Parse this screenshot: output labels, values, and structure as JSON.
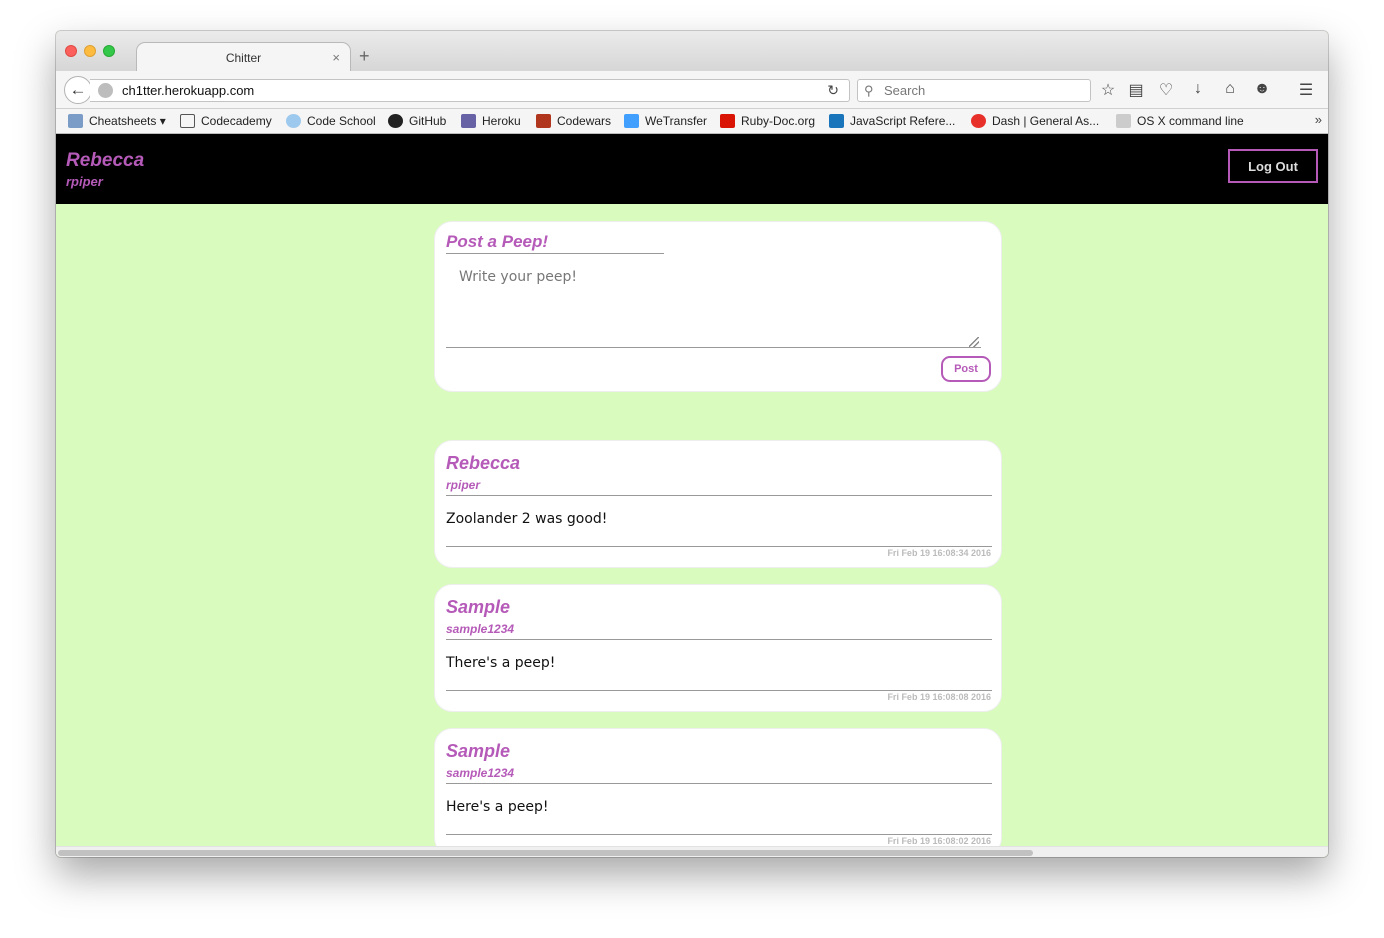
{
  "browser": {
    "tab_title": "Chitter",
    "tab_close": "×",
    "new_tab": "+",
    "url": "ch1tter.herokuapp.com",
    "search_placeholder": "Search",
    "bookmarks": [
      {
        "label": "Cheatsheets ▾",
        "icon": "folder-icon",
        "color": "#7a9cc6"
      },
      {
        "label": "Codecademy",
        "icon": "codecademy-icon",
        "color": "#ffffff"
      },
      {
        "label": "Code School",
        "icon": "codeschool-icon",
        "color": "#9ec9ee"
      },
      {
        "label": "GitHub",
        "icon": "github-icon",
        "color": "#222222"
      },
      {
        "label": "Heroku",
        "icon": "heroku-icon",
        "color": "#6762a6"
      },
      {
        "label": "Codewars",
        "icon": "codewars-icon",
        "color": "#b1361e"
      },
      {
        "label": "WeTransfer",
        "icon": "wetransfer-icon",
        "color": "#409fff"
      },
      {
        "label": "Ruby-Doc.org",
        "icon": "ruby-icon",
        "color": "#d91404"
      },
      {
        "label": "JavaScript Refere...",
        "icon": "mdn-icon",
        "color": "#1b75bb"
      },
      {
        "label": "Dash | General As...",
        "icon": "ga-icon",
        "color": "#e8302b"
      },
      {
        "label": "OS X command line",
        "icon": "page-icon",
        "color": "#cccccc"
      }
    ],
    "overflow": "»"
  },
  "header": {
    "user_name": "Rebecca",
    "user_handle": "rpiper",
    "logout_label": "Log Out"
  },
  "compose": {
    "title": "Post a Peep!",
    "placeholder": "Write your peep!",
    "button_label": "Post"
  },
  "peeps": [
    {
      "author": "Rebecca",
      "handle": "rpiper",
      "text": "Zoolander 2 was good!",
      "time": "Fri Feb 19 16:08:34 2016"
    },
    {
      "author": "Sample",
      "handle": "sample1234",
      "text": "There's a peep!",
      "time": "Fri Feb 19 16:08:08 2016"
    },
    {
      "author": "Sample",
      "handle": "sample1234",
      "text": "Here's a peep!",
      "time": "Fri Feb 19 16:08:02 2016"
    }
  ],
  "colors": {
    "accent": "#b55ab8",
    "page_background": "#d9fcbe",
    "header_background": "#000000"
  }
}
